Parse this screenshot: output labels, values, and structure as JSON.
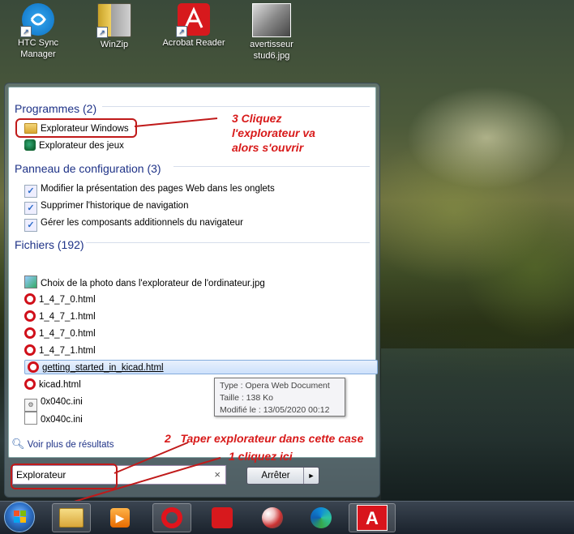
{
  "desktop": {
    "icons": [
      {
        "label": "HTC Sync\nManager",
        "icon": "htc-sync-icon"
      },
      {
        "label": "WinZip",
        "icon": "winzip-icon"
      },
      {
        "label": "Acrobat Reader",
        "icon": "acrobat-icon"
      },
      {
        "label": "avertisseur\nstud6.jpg",
        "icon": "image-file-icon"
      }
    ]
  },
  "startmenu": {
    "groups": {
      "programs": {
        "title": "Programmes (2)",
        "items": [
          "Explorateur Windows",
          "Explorateur des jeux"
        ]
      },
      "control_panel": {
        "title": "Panneau de configuration (3)",
        "items": [
          "Modifier la présentation des pages Web dans les onglets",
          "Supprimer l'historique de navigation",
          "Gérer les composants additionnels du navigateur"
        ]
      },
      "files": {
        "title": "Fichiers (192)",
        "items": [
          "Choix de la photo dans l'explorateur de l'ordinateur.jpg",
          "1_4_7_0.html",
          "1_4_7_1.html",
          "1_4_7_0.html",
          "1_4_7_1.html",
          "getting_started_in_kicad.html",
          "kicad.html",
          "0x040c.ini",
          "0x040c.ini"
        ]
      }
    },
    "tooltip": {
      "type": "Type : Opera Web Document",
      "size": "Taille : 138 Ko",
      "modified": "Modifié le : 13/05/2020 00:12"
    },
    "more_results": "Voir plus de résultats",
    "search": {
      "value": "Explorateur",
      "clear": "×"
    },
    "shutdown": {
      "label": "Arrêter",
      "arrow": "►"
    }
  },
  "annotations": {
    "step3": "3 Cliquez\nl'explorateur va\nalors s'ouvrir",
    "step2": "2   Taper explorateur dans cette case",
    "step1": "1 cliquez ici",
    "color": "#d81a1a"
  },
  "taskbar": {
    "items": [
      "start-orb",
      "file-explorer",
      "media-player",
      "opera",
      "acrobat",
      "paint",
      "edge",
      "app-a"
    ],
    "app_a_label": "A"
  }
}
